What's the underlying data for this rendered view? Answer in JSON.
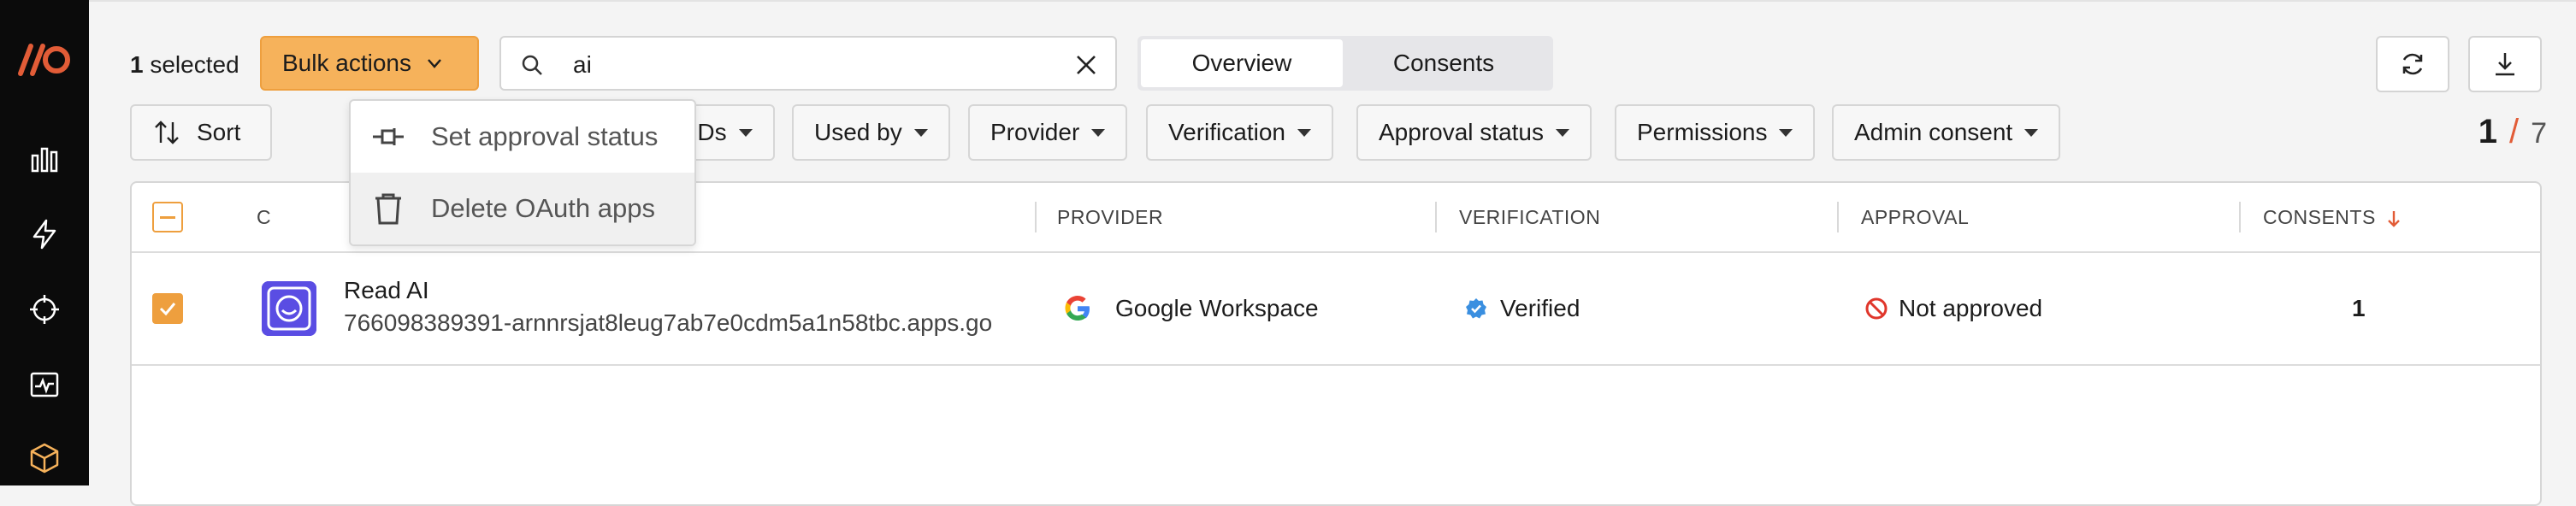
{
  "nav": {
    "logo": "logo",
    "items": [
      "analytics-icon",
      "bolt-icon",
      "crosshair-icon",
      "activity-icon",
      "package-icon"
    ]
  },
  "toolbar": {
    "selected_count": "1",
    "selected_label": " selected",
    "bulk_actions_label": "Bulk actions",
    "search_value": "ai",
    "tabs": [
      {
        "label": "Overview",
        "active": true
      },
      {
        "label": "Consents",
        "active": false
      }
    ]
  },
  "filters": {
    "sort_label": "Sort",
    "items": [
      "App IDs",
      "Used by",
      "Provider",
      "Verification",
      "Approval status",
      "Permissions",
      "Admin consent"
    ]
  },
  "pagination": {
    "current": "1",
    "separator": "/",
    "total": "7"
  },
  "table": {
    "columns": {
      "provider": "PROVIDER",
      "verification": "VERIFICATION",
      "approval": "APPROVAL",
      "consents": "CONSENTS",
      "name_partial": "C"
    },
    "rows": [
      {
        "name": "Read AI",
        "app_id": "766098389391-arnnrsjat8leug7ab7e0cdm5a1n58tbc.apps.go",
        "provider": "Google Workspace",
        "verification": "Verified",
        "approval": "Not approved",
        "consents": "1",
        "checked": true
      }
    ]
  },
  "bulk_menu": {
    "items": [
      {
        "label": "Set approval status",
        "icon": "approval-status-icon"
      },
      {
        "label": "Delete OAuth apps",
        "icon": "trash-icon"
      }
    ]
  },
  "colors": {
    "accent": "#f6b25b",
    "accent_border": "#ee9f3e",
    "nav_bg": "#0b0b0b",
    "brand_red": "#e25c37",
    "verified_blue": "#3a8fe0",
    "not_approved_red": "#e0362b",
    "app_icon_bg": "#5a4de3"
  }
}
